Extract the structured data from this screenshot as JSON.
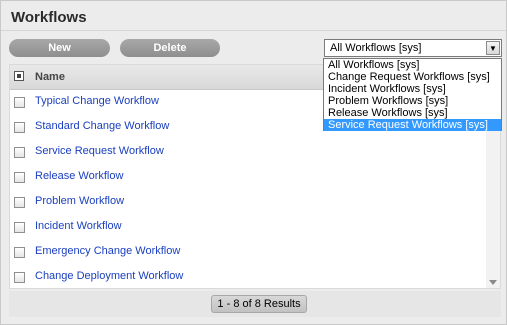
{
  "panel": {
    "title": "Workflows"
  },
  "toolbar": {
    "new_label": "New",
    "delete_label": "Delete"
  },
  "filter": {
    "selected": "All Workflows [sys]",
    "options": [
      "All Workflows [sys]",
      "Change Request Workflows [sys]",
      "Incident Workflows [sys]",
      "Problem Workflows [sys]",
      "Release Workflows [sys]",
      "Service Request Workflows [sys]"
    ],
    "highlighted_index": 5
  },
  "table": {
    "column_name": "Name",
    "rows": [
      "Typical Change Workflow",
      "Standard Change Workflow",
      "Service Request Workflow",
      "Release Workflow",
      "Problem Workflow",
      "Incident Workflow",
      "Emergency Change Workflow",
      "Change Deployment Workflow"
    ]
  },
  "pagination": {
    "label": "1 - 8 of 8 Results"
  },
  "colors": {
    "link": "#1a3fbf",
    "button": "#999999",
    "highlight": "#3399ff"
  }
}
